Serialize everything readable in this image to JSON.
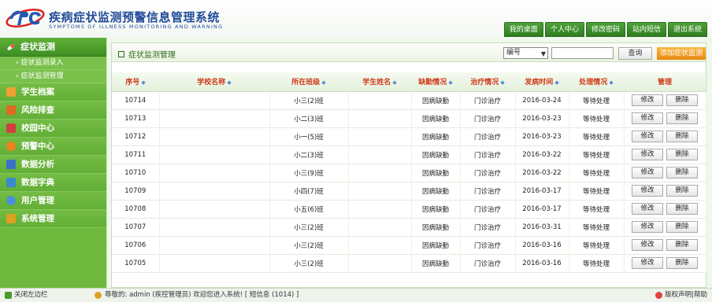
{
  "header": {
    "title": "疾病症状监测预警信息管理系统",
    "subtitle": "SYMPTOMS OF ILLNESS MONITORING AND WARNING",
    "nav": [
      "我的桌面",
      "个人中心",
      "修改密码",
      "站内短信",
      "退出系统"
    ]
  },
  "sidebar": {
    "active_section": "症状监测",
    "sub_items": [
      "症状监测录入",
      "症状监测管理"
    ],
    "items": [
      {
        "label": "学生档案",
        "icon": "folder-icon",
        "color": "#f0a030"
      },
      {
        "label": "风险排查",
        "icon": "risk-icon",
        "color": "#e06a20"
      },
      {
        "label": "校园中心",
        "icon": "school-icon",
        "color": "#d04040"
      },
      {
        "label": "预警中心",
        "icon": "alarm-icon",
        "color": "#f08020"
      },
      {
        "label": "数据分析",
        "icon": "chart-icon",
        "color": "#3a70c8"
      },
      {
        "label": "数据字典",
        "icon": "book-icon",
        "color": "#3a8ad0"
      },
      {
        "label": "用户管理",
        "icon": "users-icon",
        "color": "#4a90d8"
      },
      {
        "label": "系统管理",
        "icon": "settings-icon",
        "color": "#e0a020"
      }
    ]
  },
  "panel": {
    "title": "症状监测管理",
    "select_value": "编号",
    "search_value": "",
    "search_label": "查询",
    "add_label": "添加症状监测"
  },
  "table": {
    "headers": [
      "序号",
      "学校名称",
      "所在班级",
      "学生姓名",
      "缺勤情况",
      "治疗情况",
      "发病时间",
      "处理情况",
      "管理"
    ],
    "edit_label": "修改",
    "delete_label": "删除",
    "rows": [
      {
        "id": "10714",
        "school": "",
        "class": "小三(2)班",
        "student": "",
        "absence": "因病缺勤",
        "treatment": "门诊治疗",
        "date": "2016-03-24",
        "status": "等待处理"
      },
      {
        "id": "10713",
        "school": "",
        "class": "小二(3)班",
        "student": "",
        "absence": "因病缺勤",
        "treatment": "门诊治疗",
        "date": "2016-03-23",
        "status": "等待处理"
      },
      {
        "id": "10712",
        "school": "",
        "class": "小一(5)班",
        "student": "",
        "absence": "因病缺勤",
        "treatment": "门诊治疗",
        "date": "2016-03-23",
        "status": "等待处理"
      },
      {
        "id": "10711",
        "school": "",
        "class": "小二(3)班",
        "student": "",
        "absence": "因病缺勤",
        "treatment": "门诊治疗",
        "date": "2016-03-22",
        "status": "等待处理"
      },
      {
        "id": "10710",
        "school": "",
        "class": "小三(9)班",
        "student": "",
        "absence": "因病缺勤",
        "treatment": "门诊治疗",
        "date": "2016-03-22",
        "status": "等待处理"
      },
      {
        "id": "10709",
        "school": "",
        "class": "小四(7)班",
        "student": "",
        "absence": "因病缺勤",
        "treatment": "门诊治疗",
        "date": "2016-03-17",
        "status": "等待处理"
      },
      {
        "id": "10708",
        "school": "",
        "class": "小五(6)班",
        "student": "",
        "absence": "因病缺勤",
        "treatment": "门诊治疗",
        "date": "2016-03-17",
        "status": "等待处理"
      },
      {
        "id": "10707",
        "school": "",
        "class": "小三(2)班",
        "student": "",
        "absence": "因病缺勤",
        "treatment": "门诊治疗",
        "date": "2016-03-31",
        "status": "等待处理"
      },
      {
        "id": "10706",
        "school": "",
        "class": "小三(2)班",
        "student": "",
        "absence": "因病缺勤",
        "treatment": "门诊治疗",
        "date": "2016-03-16",
        "status": "等待处理"
      },
      {
        "id": "10705",
        "school": "",
        "class": "小三(2)班",
        "student": "",
        "absence": "因病缺勤",
        "treatment": "门诊治疗",
        "date": "2016-03-16",
        "status": "等待处理"
      }
    ]
  },
  "footer": {
    "toggle_label": "关闭左边栏",
    "welcome": "尊敬的: admin (疾控管理员) 欢迎您进入系统! [ 短信息 (1014) ]",
    "help_label": "版权声明|帮助"
  },
  "colors": {
    "primary_green": "#6db83d",
    "status_red": "#e02020",
    "header_red": "#d03a1a",
    "title_blue": "#214c9a",
    "add_orange": "#e8890f"
  }
}
